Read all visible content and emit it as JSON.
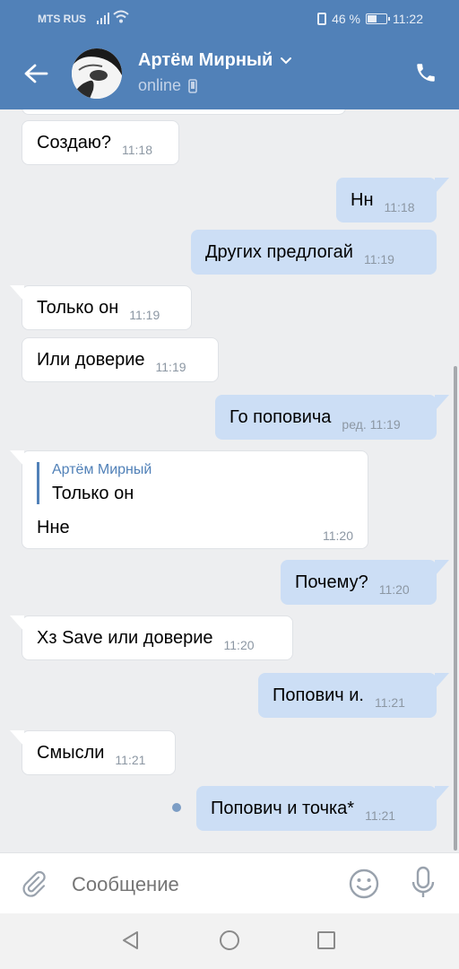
{
  "status_bar": {
    "carrier": "MTS RUS",
    "battery": "46 %",
    "time": "11:22"
  },
  "header": {
    "name": "Артём Мирный",
    "status": "online"
  },
  "messages": [
    {
      "text": "Создаю?",
      "time": "11:18"
    },
    {
      "text": "Нн",
      "time": "11:18"
    },
    {
      "text": "Других предлогай",
      "time": "11:19"
    },
    {
      "text": "Только он",
      "time": "11:19"
    },
    {
      "text": "Или доверие",
      "time": "11:19"
    },
    {
      "text": "Го поповича",
      "time": "ред. 11:19"
    },
    {
      "quote_author": "Артём Мирный",
      "quote_text": "Только он",
      "text": "Нне",
      "time": "11:20"
    },
    {
      "text": "Почему?",
      "time": "11:20"
    },
    {
      "text": "Хз Save или доверие",
      "time": "11:20"
    },
    {
      "text": "Попович и.",
      "time": "11:21"
    },
    {
      "text": "Смысли",
      "time": "11:21"
    },
    {
      "text": "Попович и точка*",
      "time": "11:21"
    }
  ],
  "composer": {
    "placeholder": "Сообщение"
  },
  "colors": {
    "header": "#5181b8",
    "incoming": "#ffffff",
    "outgoing": "#ccdef5",
    "background": "#edeef0"
  },
  "icons": [
    "back-arrow-icon",
    "chevron-down-icon",
    "mobile-icon",
    "phone-icon",
    "paperclip-icon",
    "smile-icon",
    "microphone-icon",
    "nav-back-icon",
    "nav-home-icon",
    "nav-recent-icon"
  ]
}
